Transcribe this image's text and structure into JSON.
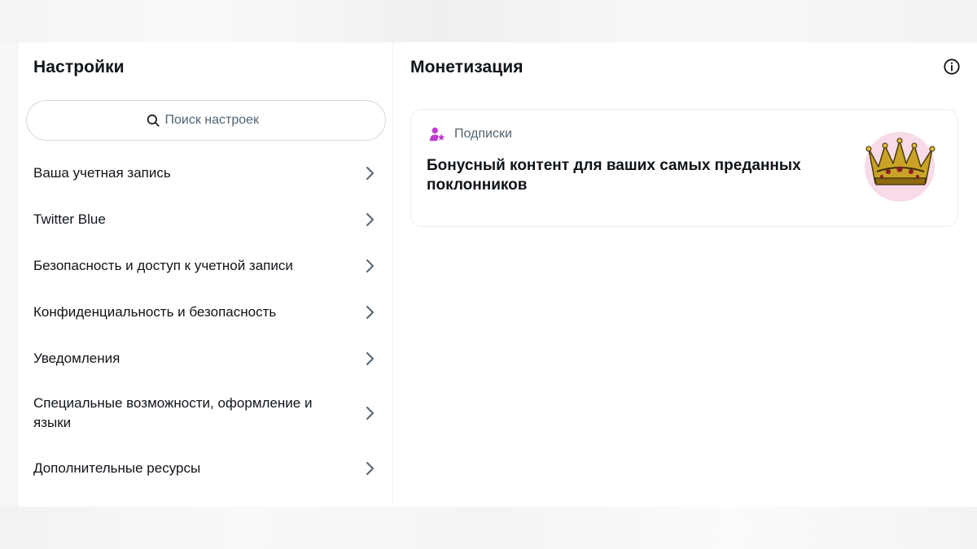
{
  "settings": {
    "title": "Настройки",
    "search": {
      "placeholder": "Поиск настроек",
      "icon": "search-icon"
    },
    "items": [
      {
        "label": "Ваша учетная запись"
      },
      {
        "label": "Twitter Blue"
      },
      {
        "label": "Безопасность и доступ к учетной записи"
      },
      {
        "label": "Конфиденциальность и безопасность"
      },
      {
        "label": "Уведомления"
      },
      {
        "label": "Специальные возможности, оформление и языки"
      },
      {
        "label": "Дополнительные ресурсы"
      }
    ]
  },
  "monetization": {
    "title": "Монетизация",
    "info_icon": "info-icon",
    "card": {
      "kicker": "Подписки",
      "kicker_icon": "subscriber-star-icon",
      "headline": "Бонусный контент для ваших самых преданных поклонников",
      "art_icon": "crown-icon"
    }
  },
  "colors": {
    "text_primary": "#0f1419",
    "text_secondary": "#536471",
    "border": "#eff3f4",
    "accent_subscriptions": "#c13bd0",
    "crown_bg": "#f7dbe8"
  }
}
